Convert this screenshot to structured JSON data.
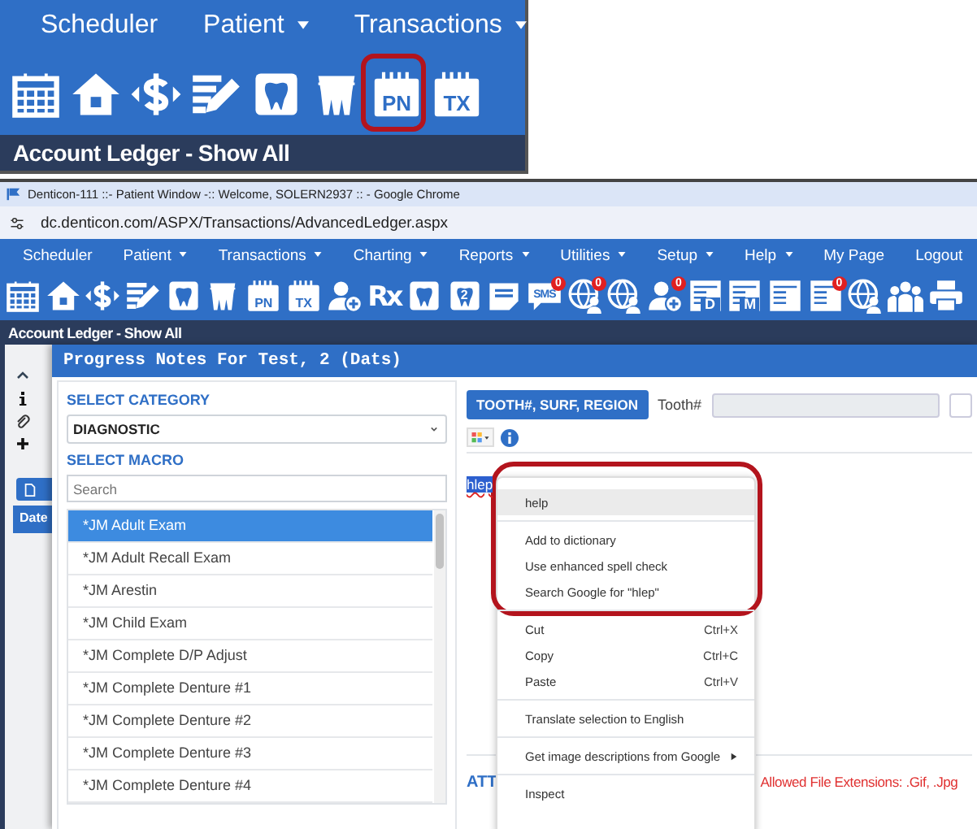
{
  "inset": {
    "nav": [
      {
        "label": "Scheduler",
        "dropdown": false
      },
      {
        "label": "Patient",
        "dropdown": true
      },
      {
        "label": "Transactions",
        "dropdown": true
      }
    ],
    "toolbar": [
      {
        "kind": "calendar",
        "highlighted": false
      },
      {
        "kind": "house",
        "highlighted": false
      },
      {
        "kind": "dollar",
        "highlighted": false
      },
      {
        "kind": "edit",
        "highlighted": false
      },
      {
        "kind": "tooth",
        "highlighted": false
      },
      {
        "kind": "teeth",
        "highlighted": false
      },
      {
        "kind": "card",
        "label": "PN",
        "highlighted": true
      },
      {
        "kind": "card",
        "label": "TX",
        "highlighted": false
      }
    ],
    "page_title": "Account Ledger - Show All"
  },
  "browser": {
    "title": "Denticon-111 ::- Patient Window -:: Welcome, SOLERN2937 :: - Google Chrome",
    "url": "dc.denticon.com/ASPX/Transactions/AdvancedLedger.aspx"
  },
  "nav": [
    {
      "label": "Scheduler",
      "dropdown": false
    },
    {
      "label": "Patient",
      "dropdown": true
    },
    {
      "label": "Transactions",
      "dropdown": true
    },
    {
      "label": "Charting",
      "dropdown": true
    },
    {
      "label": "Reports",
      "dropdown": true
    },
    {
      "label": "Utilities",
      "dropdown": true
    },
    {
      "label": "Setup",
      "dropdown": true
    },
    {
      "label": "Help",
      "dropdown": true
    },
    {
      "label": "My Page",
      "dropdown": false
    },
    {
      "label": "Logout",
      "dropdown": false
    }
  ],
  "toolbar": [
    {
      "kind": "calendar"
    },
    {
      "kind": "house"
    },
    {
      "kind": "dollar"
    },
    {
      "kind": "edit"
    },
    {
      "kind": "tooth"
    },
    {
      "kind": "teeth"
    },
    {
      "kind": "card",
      "label": "PN"
    },
    {
      "kind": "card",
      "label": "TX"
    },
    {
      "kind": "person"
    },
    {
      "kind": "rx",
      "label": "Rx"
    },
    {
      "kind": "tooth"
    },
    {
      "kind": "tooth",
      "label": "2"
    },
    {
      "kind": "note"
    },
    {
      "kind": "bubble",
      "label": "SMS",
      "badge": "0"
    },
    {
      "kind": "globe",
      "badge": "0"
    },
    {
      "kind": "globe"
    },
    {
      "kind": "person",
      "badge": "0"
    },
    {
      "kind": "doc",
      "label": "D"
    },
    {
      "kind": "doc",
      "label": "M"
    },
    {
      "kind": "doc"
    },
    {
      "kind": "doc",
      "badge": "0"
    },
    {
      "kind": "globe"
    },
    {
      "kind": "people"
    },
    {
      "kind": "printer"
    }
  ],
  "page_title": "Account Ledger - Show All",
  "table_header": "Date",
  "dialog": {
    "title": "Progress Notes For Test, 2 (Dats)",
    "category_label": "SELECT CATEGORY",
    "category": "DIAGNOSTIC",
    "macro_label": "SELECT MACRO",
    "search_placeholder": "Search",
    "macros": [
      {
        "label": "*JM Adult Exam",
        "selected": true
      },
      {
        "label": "*JM Adult Recall Exam",
        "selected": false
      },
      {
        "label": "*JM Arestin",
        "selected": false
      },
      {
        "label": "*JM Child Exam",
        "selected": false
      },
      {
        "label": "*JM Complete D/P Adjust",
        "selected": false
      },
      {
        "label": "*JM Complete Denture #1",
        "selected": false
      },
      {
        "label": "*JM Complete Denture #2",
        "selected": false
      },
      {
        "label": "*JM Complete Denture #3",
        "selected": false
      },
      {
        "label": "*JM Complete Denture #4",
        "selected": false
      }
    ],
    "tooth_button": "TOOTH#, SURF, REGION",
    "tooth_label": "Tooth#",
    "note_text": "hlep",
    "attachments_label": "ATT",
    "extensions_note": "Allowed File Extensions: .Gif, .Jpg"
  },
  "context_menu": {
    "sections": [
      {
        "highlighted": true,
        "items": [
          {
            "kind": "item",
            "label": "help",
            "selected": true,
            "submenu": false
          },
          {
            "kind": "separator"
          },
          {
            "kind": "item",
            "label": "Add to dictionary",
            "selected": false,
            "submenu": false
          },
          {
            "kind": "item",
            "label": "Use enhanced spell check",
            "selected": false,
            "submenu": false
          },
          {
            "kind": "item",
            "label": "Search Google for \"hlep\"",
            "selected": false,
            "submenu": false
          }
        ]
      },
      {
        "highlighted": false,
        "items": [
          {
            "kind": "separator"
          },
          {
            "kind": "item",
            "label": "Cut",
            "shortcut": "Ctrl+X",
            "selected": false,
            "submenu": false
          },
          {
            "kind": "item",
            "label": "Copy",
            "shortcut": "Ctrl+C",
            "selected": false,
            "submenu": false
          },
          {
            "kind": "item",
            "label": "Paste",
            "shortcut": "Ctrl+V",
            "selected": false,
            "submenu": false
          },
          {
            "kind": "separator"
          },
          {
            "kind": "item",
            "label": "Translate selection to English",
            "selected": false,
            "submenu": false
          },
          {
            "kind": "separator"
          },
          {
            "kind": "item",
            "label": "Get image descriptions from Google",
            "selected": false,
            "submenu": true
          },
          {
            "kind": "separator"
          },
          {
            "kind": "item",
            "label": "Inspect",
            "selected": false,
            "submenu": false
          }
        ]
      }
    ]
  }
}
